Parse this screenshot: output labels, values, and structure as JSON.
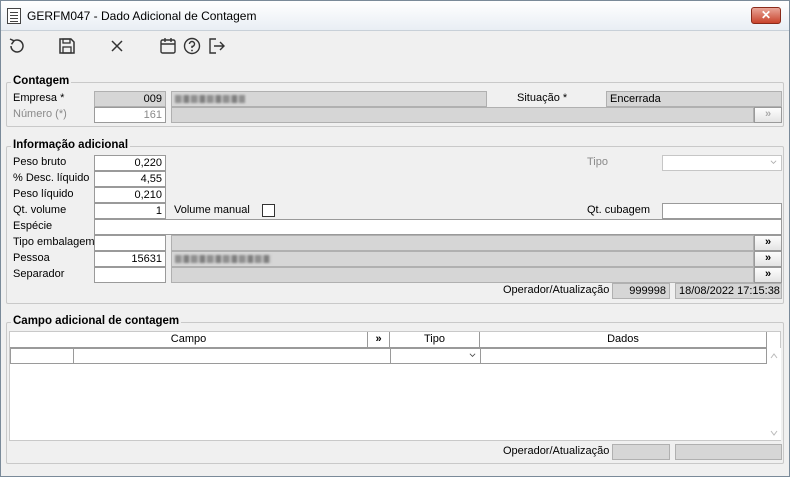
{
  "window": {
    "title": "GERFM047 - Dado Adicional de Contagem",
    "close_label": "✕"
  },
  "toolbar": {
    "items": [
      {
        "name": "refresh-icon"
      },
      {
        "name": "save-icon"
      },
      {
        "name": "cancel-icon"
      },
      {
        "name": "calendar-icon"
      },
      {
        "name": "help-icon"
      },
      {
        "name": "exit-icon"
      }
    ]
  },
  "contagem": {
    "title": "Contagem",
    "empresa_label": "Empresa *",
    "empresa_code": "009",
    "situacao_label": "Situação *",
    "situacao_value": "Encerrada",
    "numero_label": "Número (*)",
    "numero_value": "161",
    "more_label": "»"
  },
  "info": {
    "title": "Informação adicional",
    "peso_bruto_label": "Peso bruto",
    "peso_bruto_value": "0,220",
    "desc_liquido_label": "% Desc. líquido",
    "desc_liquido_value": "4,55",
    "peso_liquido_label": "Peso líquido",
    "peso_liquido_value": "0,210",
    "qt_volume_label": "Qt. volume",
    "qt_volume_value": "1",
    "volume_manual_label": "Volume manual",
    "especie_label": "Espécie",
    "tipo_embalagem_label": "Tipo embalagem",
    "pessoa_label": "Pessoa",
    "pessoa_value": "15631",
    "separador_label": "Separador",
    "tipo_label": "Tipo",
    "qt_cubagem_label": "Qt. cubagem",
    "operador_label": "Operador/Atualização",
    "operador_value": "999998",
    "atualizacao_value": "18/08/2022 17:15:38",
    "more_label": "»"
  },
  "campo": {
    "title": "Campo adicional de contagem",
    "col_campo": "Campo",
    "col_more": "»",
    "col_tipo": "Tipo",
    "col_dados": "Dados",
    "operador_label": "Operador/Atualização"
  }
}
